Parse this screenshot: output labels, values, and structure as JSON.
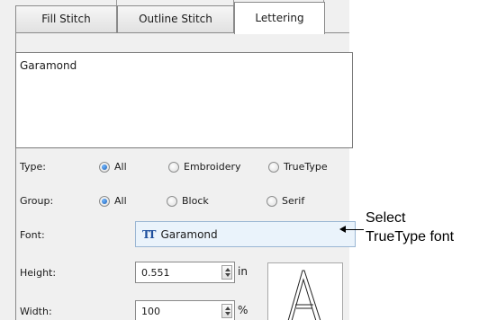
{
  "tabs": [
    {
      "label": "Fill Stitch"
    },
    {
      "label": "Outline Stitch"
    },
    {
      "label": "Lettering"
    }
  ],
  "text_area": {
    "value": "Garamond"
  },
  "type_row": {
    "label": "Type:",
    "options": [
      "All",
      "Embroidery",
      "TrueType"
    ],
    "selected": "All"
  },
  "group_row": {
    "label": "Group:",
    "options": [
      "All",
      "Block",
      "Serif"
    ],
    "selected": "All"
  },
  "font_row": {
    "label": "Font:",
    "icon": "truetype-icon",
    "value": "Garamond"
  },
  "height_row": {
    "label": "Height:",
    "value": "0.551",
    "unit": "in"
  },
  "width_row": {
    "label": "Width:",
    "value": "100",
    "unit": "%"
  },
  "callout": {
    "line1": "Select",
    "line2": "TrueType font"
  },
  "colors": {
    "active_tab": "#ffffff",
    "radio_selected": "#1f5fb2",
    "font_field_bg": "#eaf3fb"
  }
}
